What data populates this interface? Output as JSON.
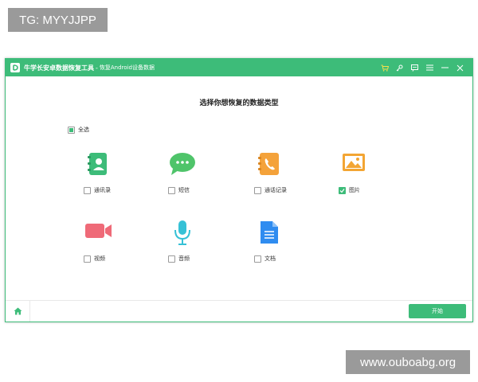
{
  "watermarks": {
    "top": "TG: MYYJJPP",
    "bottom": "www.ouboabg.org"
  },
  "window": {
    "title": "牛学长安卓数据恢复工具",
    "separator": "-",
    "subtitle": "恢复Android设备数据",
    "accent_color": "#3dbc79",
    "toolbar_icons": [
      "cart-icon",
      "key-icon",
      "feedback-icon",
      "menu-icon",
      "minimize-icon",
      "close-icon"
    ]
  },
  "main": {
    "heading": "选择你想恢复的数据类型",
    "select_all": {
      "label": "全选",
      "state": "partial"
    },
    "types": [
      {
        "label": "通讯录",
        "icon": "contacts-icon",
        "checked": false
      },
      {
        "label": "短信",
        "icon": "messages-icon",
        "checked": false
      },
      {
        "label": "通话记录",
        "icon": "call-log-icon",
        "checked": false
      },
      {
        "label": "图片",
        "icon": "photos-icon",
        "checked": true
      },
      {
        "label": "视频",
        "icon": "video-icon",
        "checked": false
      },
      {
        "label": "音频",
        "icon": "audio-icon",
        "checked": false
      },
      {
        "label": "文档",
        "icon": "documents-icon",
        "checked": false
      }
    ]
  },
  "footer": {
    "home_icon": "home-icon",
    "start_label": "开始"
  }
}
